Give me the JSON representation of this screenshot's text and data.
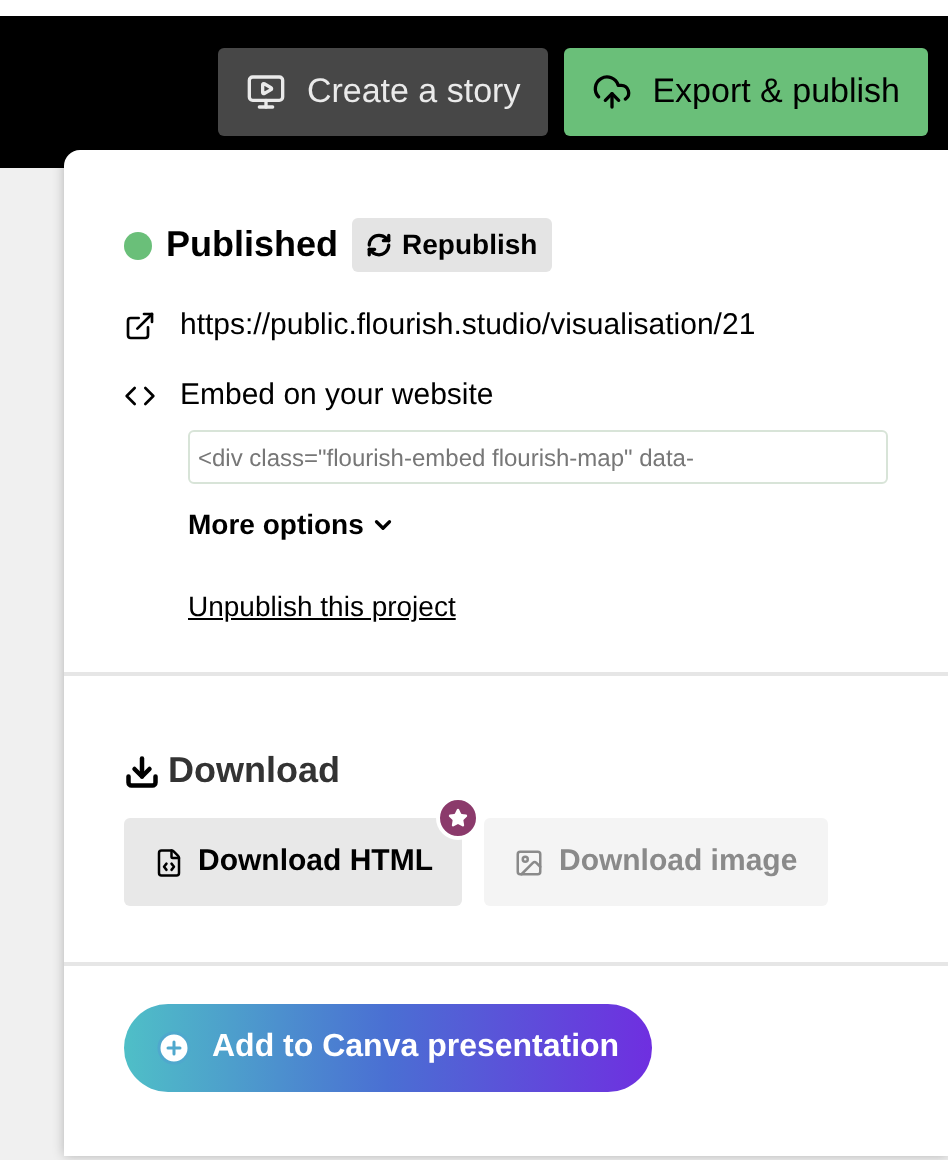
{
  "header": {
    "buttons": [
      {
        "label": "Create a story",
        "kind": "story"
      },
      {
        "label": "Export & publish",
        "kind": "export"
      }
    ]
  },
  "publish": {
    "status": "Published",
    "published": true,
    "republish": "Republish",
    "url": "https://public.flourish.studio/visualisation/21",
    "embed_label": "Embed on your website",
    "embed_code": "<div class=\"flourish-embed flourish-map\" data-",
    "more_options": "More options",
    "unpublish": "Unpublish this project"
  },
  "download": {
    "title": "Download",
    "buttons": [
      {
        "label": "Download HTML",
        "kind": "html",
        "disabled": false,
        "premium": true
      },
      {
        "label": "Download image",
        "kind": "image",
        "disabled": true,
        "premium": false
      }
    ]
  },
  "canva": {
    "label": "Add to Canva presentation"
  }
}
